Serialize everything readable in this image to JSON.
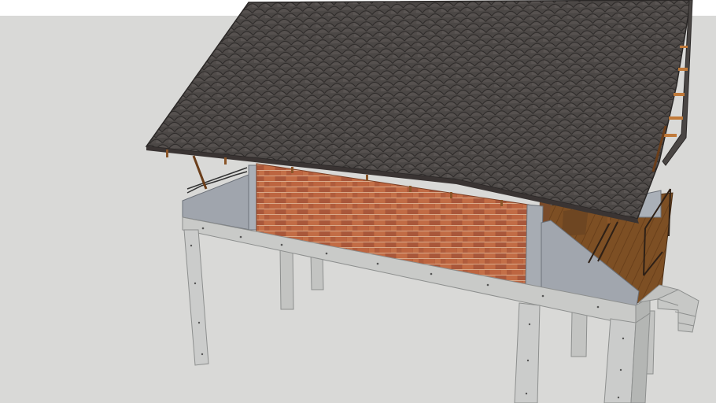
{
  "scene": {
    "subject": "3d-model-stilt-house",
    "colors": {
      "sky": "#ffffff",
      "ground": "#d9d9d7",
      "roof_tile": "#4a4644",
      "roof_tile_edge": "#2a2726",
      "brick": "#b8623e",
      "mortar": "#c99a7a",
      "concrete": "#c9cac8",
      "concrete_shadow": "#a9abaa",
      "wall_panel": "#9ea3ab",
      "timber": "#8a5528",
      "deck": "#7a4d22",
      "railing": "#3a2a1e"
    }
  }
}
